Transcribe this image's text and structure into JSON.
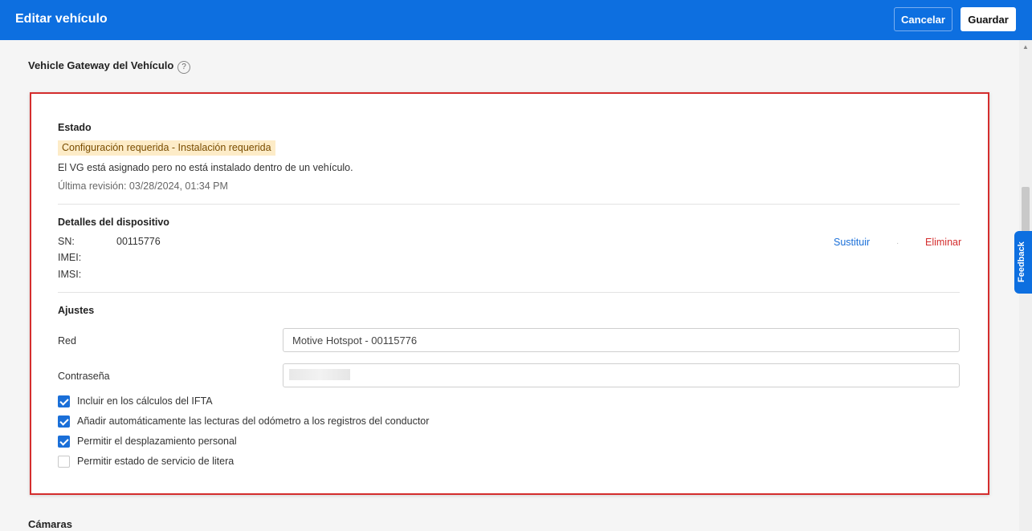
{
  "header": {
    "title": "Editar vehículo",
    "cancel_label": "Cancelar",
    "save_label": "Guardar"
  },
  "section": {
    "title": "Vehicle Gateway del Vehículo",
    "help_icon": "question-circle-icon"
  },
  "estado": {
    "heading": "Estado",
    "badge": "Configuración requerida - Instalación requerida",
    "description": "El VG está asignado pero no está instalado dentro de un vehículo.",
    "last_review": "Última revisión: 03/28/2024, 01:34 PM"
  },
  "device": {
    "heading": "Detalles del dispositivo",
    "sn_label": "SN:",
    "sn_value": "00115776",
    "imei_label": "IMEI:",
    "imsi_label": "IMSI:",
    "replace_label": "Sustituir",
    "delete_label": "Eliminar"
  },
  "settings": {
    "heading": "Ajustes",
    "network_label": "Red",
    "network_value": "Motive Hotspot - 00115776",
    "password_label": "Contraseña",
    "checkboxes": [
      {
        "label": "Incluir en los cálculos del IFTA",
        "checked": true
      },
      {
        "label": "Añadir automáticamente las lecturas del odómetro a los registros del conductor",
        "checked": true
      },
      {
        "label": "Permitir el desplazamiento personal",
        "checked": true
      },
      {
        "label": "Permitir estado de servicio de litera",
        "checked": false
      }
    ]
  },
  "feedback_label": "Feedback",
  "next_section_title": "Cámaras",
  "colors": {
    "primary": "#0d6fe0",
    "highlight_border": "#d42d2d",
    "badge_bg": "#fdecc8",
    "link_blue": "#1a6fd8",
    "link_red": "#d42d2d"
  }
}
